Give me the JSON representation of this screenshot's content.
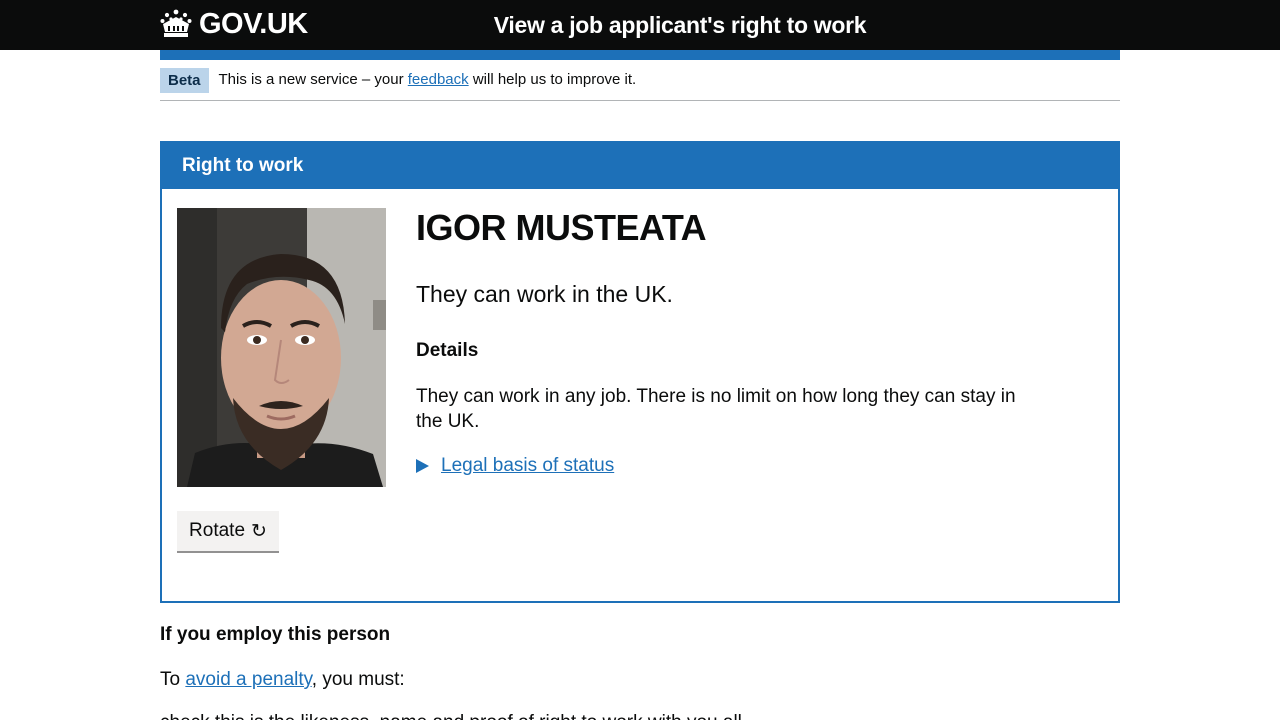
{
  "header": {
    "logo_text": "GOV.UK",
    "service_name": "View a job applicant's right to work"
  },
  "phase_banner": {
    "tag": "Beta",
    "text_before": "This is a new service – your ",
    "link": "feedback",
    "text_after": " will help us to improve it."
  },
  "panel": {
    "title": "Right to work",
    "name": "IGOR MUSTEATA",
    "status": "They can work in the UK.",
    "details_heading": "Details",
    "details_text": "They can work in any job. There is no limit on how long they can stay in the UK.",
    "legal_link": "Legal basis of status",
    "rotate_label": "Rotate",
    "rotate_icon": "↻"
  },
  "employ": {
    "heading": "If you employ this person",
    "text_before": "To ",
    "link": "avoid a penalty",
    "text_after": ", you must:",
    "next_item": "check this is the likeness, name and proof of right to work with you all"
  },
  "colors": {
    "header_bg": "#0b0c0c",
    "brand_blue": "#1d70b8",
    "tag_bg": "#bbd4ea",
    "button_bg": "#f3f2f1"
  },
  "icons": {
    "logo": "crown-icon",
    "rotate": "rotate-icon",
    "details_toggle": "triangle-right-icon"
  }
}
